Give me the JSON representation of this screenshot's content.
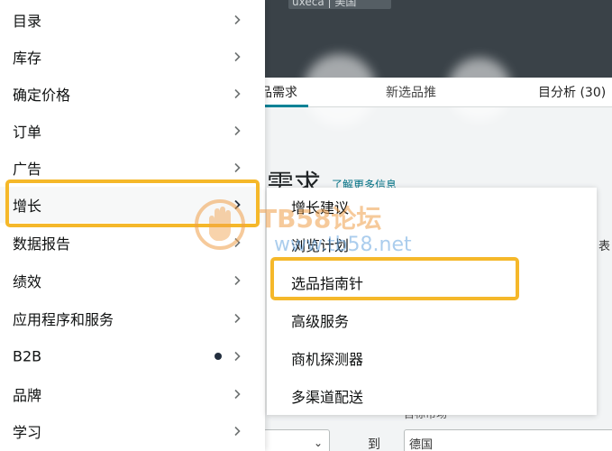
{
  "background": {
    "topbar_chip_text": "uxeca | 美国",
    "tabs": [
      {
        "label": "品需求"
      },
      {
        "label": "新选品推"
      },
      {
        "label": "目分析 (30)"
      }
    ],
    "heading": "需求",
    "link_text": "了解更多信息",
    "filter_label": "目标市场",
    "to_label": "到",
    "country_select_value": "德国",
    "peek_text": "表"
  },
  "main_menu": {
    "items": [
      {
        "label": "目录",
        "has_dot": false
      },
      {
        "label": "库存",
        "has_dot": false
      },
      {
        "label": "确定价格",
        "has_dot": false
      },
      {
        "label": "订单",
        "has_dot": false
      },
      {
        "label": "广告",
        "has_dot": false
      },
      {
        "label": "增长",
        "has_dot": false
      },
      {
        "label": "数据报告",
        "has_dot": false
      },
      {
        "label": "绩效",
        "has_dot": false
      },
      {
        "label": "应用程序和服务",
        "has_dot": false
      },
      {
        "label": "B2B",
        "has_dot": true
      },
      {
        "label": "品牌",
        "has_dot": false
      },
      {
        "label": "学习",
        "has_dot": false
      }
    ],
    "active_index": 5
  },
  "sub_menu": {
    "items": [
      {
        "label": "增长建议"
      },
      {
        "label": "浏览计划"
      },
      {
        "label": "选品指南针"
      },
      {
        "label": "高级服务"
      },
      {
        "label": "商机探测器"
      },
      {
        "label": "多渠道配送"
      }
    ],
    "highlighted_index": 2
  },
  "watermark": {
    "title": "TB58论坛",
    "url": "www.tb58.net"
  },
  "colors": {
    "highlight": "#f5b82a",
    "text": "#0f1111",
    "topbar": "#3a4248",
    "accent": "#008296"
  },
  "icons": {
    "menu_chevron": "chevron-right-icon",
    "new_dot": "dot-icon",
    "watermark": "hand-logo-icon"
  }
}
